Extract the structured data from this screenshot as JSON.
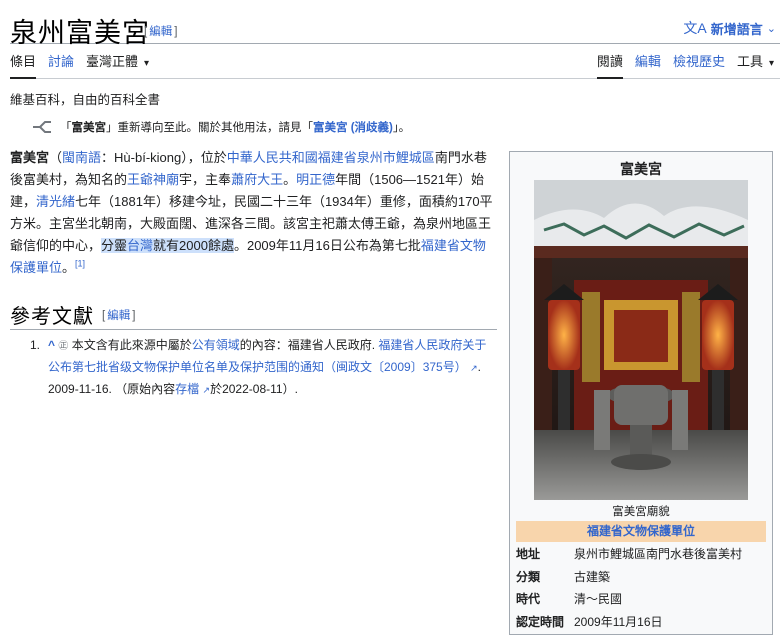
{
  "page": {
    "title": "泉州富美宮",
    "edit_label": "編輯",
    "lang_button": "新增語言",
    "subtitle": "維基百科，自由的百科全書"
  },
  "tabs": {
    "left": [
      {
        "label": "條目",
        "active": true
      },
      {
        "label": "討論",
        "active": false
      },
      {
        "label": "臺灣正體",
        "active": false
      }
    ],
    "right": [
      {
        "label": "閱讀",
        "active": true
      },
      {
        "label": "編輯",
        "active": false
      },
      {
        "label": "檢視歷史",
        "active": false
      },
      {
        "label": "工具",
        "active": false
      }
    ]
  },
  "hatnote": {
    "pre": "「",
    "redirect": "富美宮",
    "mid": "」重新導向至此。關於其他用法，請見「",
    "link": "富美宮 (消歧義)",
    "post": "」。"
  },
  "article": {
    "p1": "富美宮",
    "p2": "（",
    "p3": "閩南語",
    "p4": "：Hù-bí-kiong），位於",
    "p5": "中華人民共和國",
    "p6": "福建省",
    "p7": "泉州市",
    "p8": "鯉城區",
    "p9": "南門水巷後富美村，為知名的",
    "p10": "王爺神廟",
    "p11": "宇",
    "p12": "，主奉",
    "p13": "蕭府大王",
    "p14": "。",
    "p15": "明正德",
    "p16": "年間（1506—1521年）始建，",
    "p17": "清光緒",
    "p18": "七年（1881年）移建今址，民國二十三年（1934年）重修，面積約170平方米。主宮坐北朝南，大殿面闊、進深各三間。該宮主祀蕭太傅王爺，為泉州地區王爺信仰的中心，",
    "p19": "分靈",
    "p20": "台灣",
    "p21": "就有2000餘處",
    "p22": "。2009年11月16日公布為第七批",
    "p23": "福建省文物保護單位",
    "p24": "。",
    "sup": "[1]"
  },
  "refs_section": {
    "title": "參考文獻",
    "edit_label": "編輯",
    "items": [
      {
        "num": "1.",
        "caret": "^",
        "pd_icon": "㊣",
        "t1": "本文含有此來源中屬於",
        "t2": "公有領域",
        "t3": "的內容：福建省人民政府. ",
        "t4": "福建省人民政府关于公布第七批省级文物保护单位名单及保护范围的通知（闽政文〔2009〕375号）",
        "t5": ". 2009-11-16. （原始內容",
        "t6": "存檔",
        "t7": "於2022-08-11）."
      }
    ]
  },
  "infobox": {
    "title": "富美宮",
    "caption": "富美宮廟貌",
    "band": "福建省文物保護單位",
    "rows": [
      {
        "key": "地址",
        "value": "泉州市鯉城區南門水巷後富美村"
      },
      {
        "key": "分類",
        "value": "古建築"
      },
      {
        "key": "時代",
        "value": "清～民國"
      },
      {
        "key": "認定時間",
        "value": "2009年11月16日"
      }
    ]
  },
  "colors": {
    "link": "#3366cc",
    "band": "#f8d5ac",
    "highlight": "#cde0fb"
  }
}
